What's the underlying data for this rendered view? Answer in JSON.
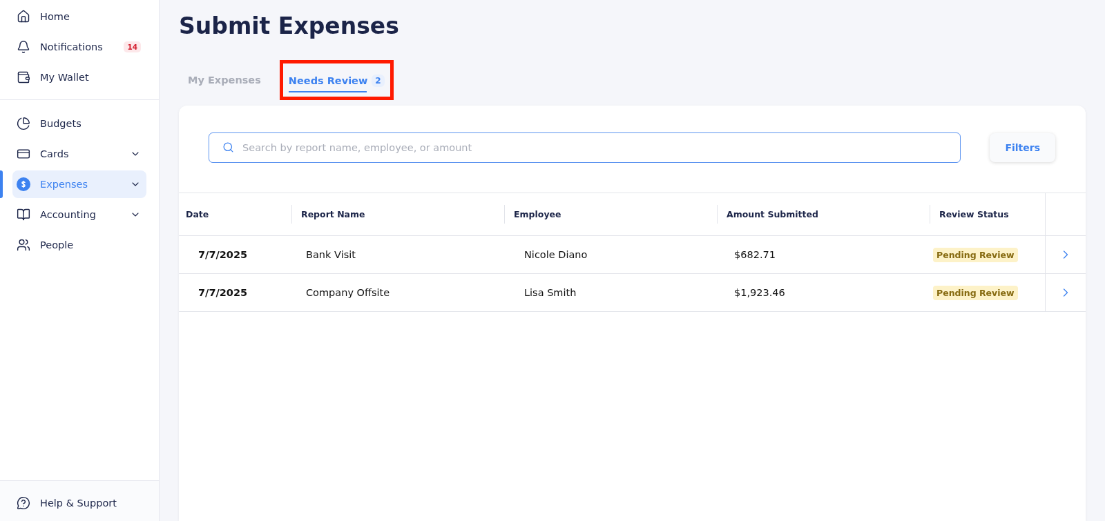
{
  "sidebar": {
    "top_items": [
      {
        "label": "Home",
        "selected": false
      },
      {
        "label": "Notifications",
        "badge": "14",
        "selected": false
      },
      {
        "label": "My Wallet",
        "selected": false
      }
    ],
    "main_items": [
      {
        "label": "Budgets",
        "expandable": false,
        "selected": false
      },
      {
        "label": "Cards",
        "expandable": true,
        "selected": false
      },
      {
        "label": "Expenses",
        "expandable": true,
        "selected": true
      },
      {
        "label": "Accounting",
        "expandable": true,
        "selected": false
      },
      {
        "label": "People",
        "expandable": false,
        "selected": false
      }
    ],
    "footer": {
      "label": "Help & Support"
    }
  },
  "page_title": "Submit Expenses",
  "tabs": [
    {
      "label": "My Expenses",
      "selected": false,
      "highlighted": false
    },
    {
      "label": "Needs Review",
      "count": "2",
      "selected": true,
      "highlighted": true
    }
  ],
  "search": {
    "placeholder": "Search by report name, employee, or amount"
  },
  "filters_button": "Filters",
  "table": {
    "columns": [
      "Date",
      "Report Name",
      "Employee",
      "Amount Submitted",
      "Review Status"
    ],
    "rows": [
      {
        "date": "7/7/2025",
        "report_name": "Bank Visit",
        "employee": "Nicole Diano",
        "amount": "$682.71",
        "status": "Pending Review"
      },
      {
        "date": "7/7/2025",
        "report_name": "Company Offsite",
        "employee": "Lisa Smith",
        "amount": "$1,923.46",
        "status": "Pending Review"
      }
    ]
  }
}
